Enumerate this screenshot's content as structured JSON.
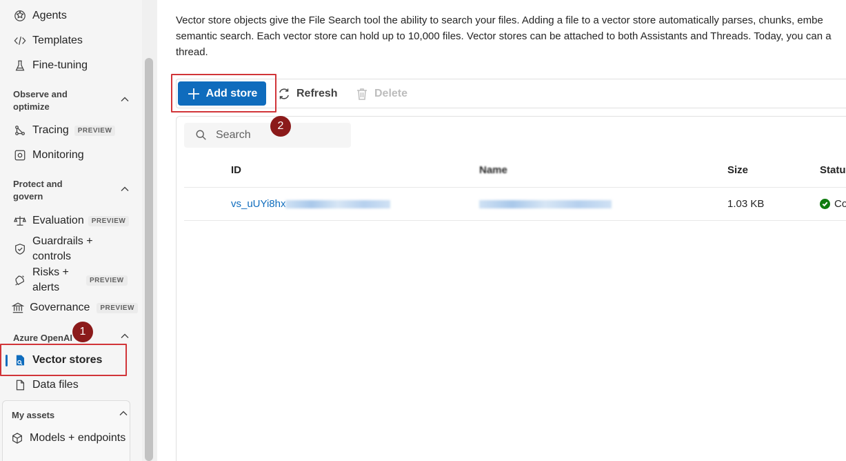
{
  "sidebar": {
    "items_top": [
      {
        "label": "Agents",
        "icon": "agents-icon"
      },
      {
        "label": "Templates",
        "icon": "code-icon"
      },
      {
        "label": "Fine-tuning",
        "icon": "flask-icon"
      }
    ],
    "observe": {
      "title_line1": "Observe and",
      "title_line2": "optimize",
      "items": [
        {
          "label": "Tracing",
          "badge": "PREVIEW"
        },
        {
          "label": "Monitoring"
        }
      ]
    },
    "protect": {
      "title_line1": "Protect and",
      "title_line2": "govern",
      "items": [
        {
          "label": "Evaluation",
          "badge": "PREVIEW"
        },
        {
          "label_line1": "Guardrails +",
          "label_line2": "controls"
        },
        {
          "label_line1": "Risks +",
          "label_line2": "alerts",
          "badge": "PREVIEW"
        },
        {
          "label": "Governance",
          "badge": "PREVIEW"
        }
      ]
    },
    "azure_openai": {
      "title": "Azure OpenAI",
      "items": [
        {
          "label": "Vector stores",
          "active": true
        },
        {
          "label": "Data files"
        }
      ]
    },
    "my_assets": {
      "title": "My assets",
      "items": [
        {
          "label": "Models + endpoints"
        }
      ]
    }
  },
  "steps": {
    "one": "1",
    "two": "2"
  },
  "main": {
    "description_lines": [
      "Vector store objects give the File Search tool the ability to search your files. Adding a file to a vector store automatically parses, chunks, embe",
      "semantic search. Each vector store can hold up to 10,000 files. Vector stores can be attached to both Assistants and Threads. Today, you can a",
      "thread."
    ],
    "toolbar": {
      "add_label": "Add store",
      "refresh_label": "Refresh",
      "delete_label": "Delete"
    },
    "search": {
      "placeholder": "Search"
    },
    "table": {
      "columns": [
        "ID",
        "Name",
        "Size",
        "Statu"
      ],
      "rows": [
        {
          "id": "vs_uUYi8hx",
          "size": "1.03 KB",
          "status": "Co"
        }
      ]
    }
  },
  "colors": {
    "primary": "#0f6cbd",
    "highlight": "#d13438",
    "step_badge": "#8b1a1a",
    "success": "#107c10"
  }
}
